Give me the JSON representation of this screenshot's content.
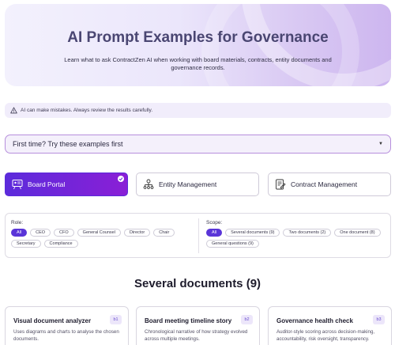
{
  "hero": {
    "title": "AI Prompt Examples for Governance",
    "subtitle": "Learn what to ask ContractZen AI when working with board materials, contracts, entity documents and governance records."
  },
  "warning": {
    "text": "AI can make mistakes. Always review the results carefully.",
    "icon": "warning-triangle-icon"
  },
  "dropdown": {
    "label": "First time? Try these examples first"
  },
  "categories": [
    {
      "label": "Board Portal",
      "icon": "presentation-board-icon",
      "active": true
    },
    {
      "label": "Entity Management",
      "icon": "org-chart-icon",
      "active": false
    },
    {
      "label": "Contract Management",
      "icon": "contract-sign-icon",
      "active": false
    }
  ],
  "filters": {
    "role": {
      "label": "Role:",
      "options": [
        "All",
        "CEO",
        "CFO",
        "General Counsel",
        "Director",
        "Chair",
        "Secretary",
        "Compliance"
      ],
      "selected": "All"
    },
    "scope": {
      "label": "Scope:",
      "options": [
        "All",
        "Several documents (9)",
        "Two documents (2)",
        "One document (8)",
        "General questions (9)"
      ],
      "selected": "All"
    }
  },
  "section": {
    "title": "Several documents (9)"
  },
  "cards": [
    {
      "title": "Visual document analyzer",
      "badge": "b1",
      "description": "Uses diagrams and charts to analyse the chosen documents."
    },
    {
      "title": "Board meeting timeline story",
      "badge": "b2",
      "description": "Chronological narrative of how strategy evolved across multiple meetings."
    },
    {
      "title": "Governance health check",
      "badge": "b3",
      "description": "Auditor-style scoring across decision-making, accountability, risk oversight, transparency."
    }
  ],
  "colors": {
    "accent": "#5a35d8",
    "accent_gradient_end": "#8a1fd6",
    "hero_bg": "#ebe6fb"
  }
}
